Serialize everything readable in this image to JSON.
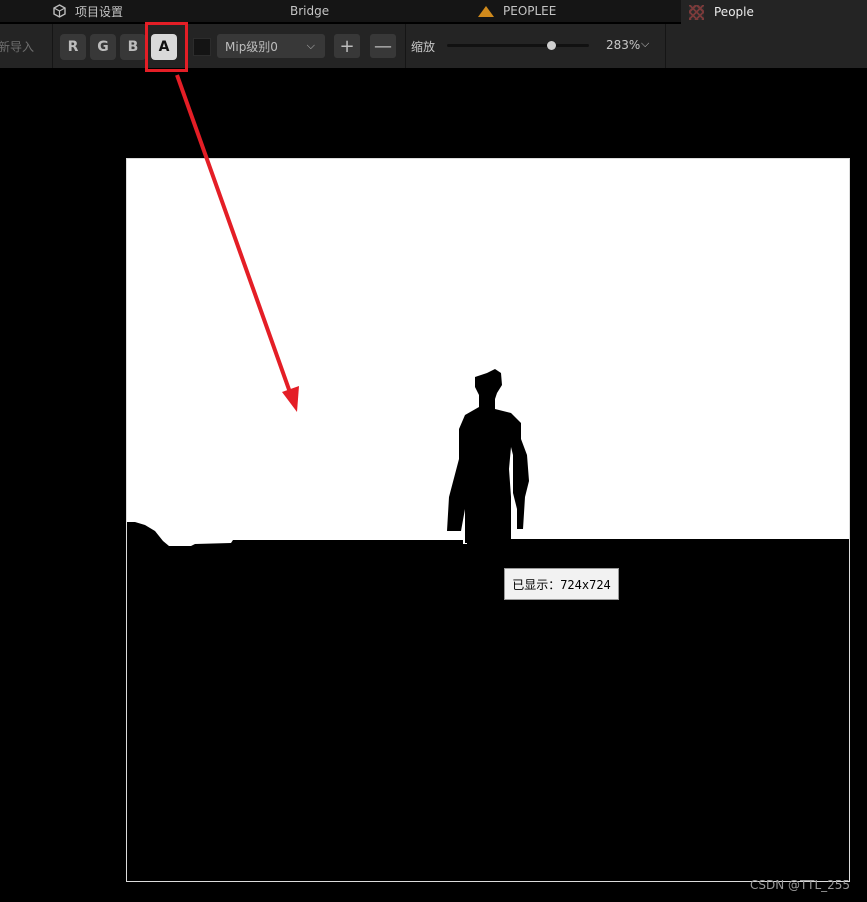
{
  "tabs": [
    {
      "label": "项目设置",
      "icon": "gear-cube-icon"
    },
    {
      "label": "Bridge"
    },
    {
      "label": "PEOPLEE",
      "icon": "sequencer-icon",
      "icon_color": "#d08a1c"
    },
    {
      "label": "People",
      "icon": "texture-icon",
      "active": true
    }
  ],
  "toolbar": {
    "reimport_label": "新导入",
    "channels": [
      {
        "label": "R",
        "active": false
      },
      {
        "label": "G",
        "active": false
      },
      {
        "label": "B",
        "active": false
      },
      {
        "label": "A",
        "active": true
      }
    ],
    "mip_select": {
      "value": "Mip级别0"
    },
    "plus_label": "+",
    "minus_label": "—",
    "zoom_label": "缩放",
    "zoom_value": "283%"
  },
  "viewer": {
    "displayed_size_tooltip": "已显示：724x724"
  },
  "annotation": {
    "color": "#e41e26",
    "target": "A channel button"
  },
  "watermark": "CSDN @TTL_255"
}
